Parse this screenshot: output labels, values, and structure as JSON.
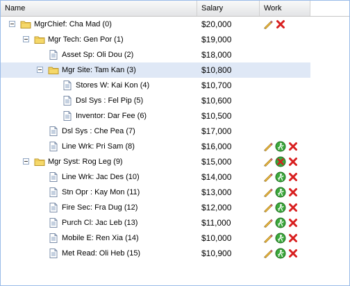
{
  "columns": {
    "name": "Name",
    "salary": "Salary",
    "work": "Work"
  },
  "rows": [
    {
      "label": "MgrChief: Cha Mad (0)",
      "salary": "$20,000",
      "folder": true,
      "level": 0,
      "actions": [
        "edit",
        "delete"
      ]
    },
    {
      "label": "Mgr Tech: Gen Por (1)",
      "salary": "$19,000",
      "folder": true,
      "level": 1,
      "actions": []
    },
    {
      "label": "Asset Sp: Oli Dou (2)",
      "salary": "$18,000",
      "folder": false,
      "level": 2,
      "actions": []
    },
    {
      "label": "Mgr Site: Tam Kan (3)",
      "salary": "$10,800",
      "folder": true,
      "level": 2,
      "actions": [],
      "selected": true
    },
    {
      "label": "Stores W: Kai Kon (4)",
      "salary": "$10,700",
      "folder": false,
      "level": 3,
      "actions": []
    },
    {
      "label": "Dsl Sys : Fel Pip (5)",
      "salary": "$10,600",
      "folder": false,
      "level": 3,
      "actions": []
    },
    {
      "label": "Inventor: Dar Fee (6)",
      "salary": "$10,500",
      "folder": false,
      "level": 3,
      "actions": []
    },
    {
      "label": "Dsl Sys : Che Pea (7)",
      "salary": "$17,000",
      "folder": false,
      "level": 2,
      "actions": []
    },
    {
      "label": "Line Wrk: Pri Sam (8)",
      "salary": "$16,000",
      "folder": false,
      "level": 2,
      "actions": [
        "edit",
        "go",
        "delete"
      ]
    },
    {
      "label": "Mgr Syst: Rog Leg (9)",
      "salary": "$15,000",
      "folder": true,
      "level": 1,
      "actions": [
        "edit",
        "stop",
        "delete"
      ]
    },
    {
      "label": "Line Wrk: Jac Des (10)",
      "salary": "$14,000",
      "folder": false,
      "level": 2,
      "actions": [
        "edit",
        "go",
        "delete"
      ]
    },
    {
      "label": "Stn Opr : Kay Mon (11)",
      "salary": "$13,000",
      "folder": false,
      "level": 2,
      "actions": [
        "edit",
        "go",
        "delete"
      ]
    },
    {
      "label": "Fire Sec: Fra Dug (12)",
      "salary": "$12,000",
      "folder": false,
      "level": 2,
      "actions": [
        "edit",
        "go",
        "delete"
      ]
    },
    {
      "label": "Purch Cl: Jac Leb (13)",
      "salary": "$11,000",
      "folder": false,
      "level": 2,
      "actions": [
        "edit",
        "go",
        "delete"
      ]
    },
    {
      "label": "Mobile E: Ren Xia (14)",
      "salary": "$10,000",
      "folder": false,
      "level": 2,
      "actions": [
        "edit",
        "go",
        "delete"
      ]
    },
    {
      "label": "Met Read: Oli Heb (15)",
      "salary": "$10,900",
      "folder": false,
      "level": 2,
      "actions": [
        "edit",
        "go",
        "delete"
      ]
    }
  ]
}
